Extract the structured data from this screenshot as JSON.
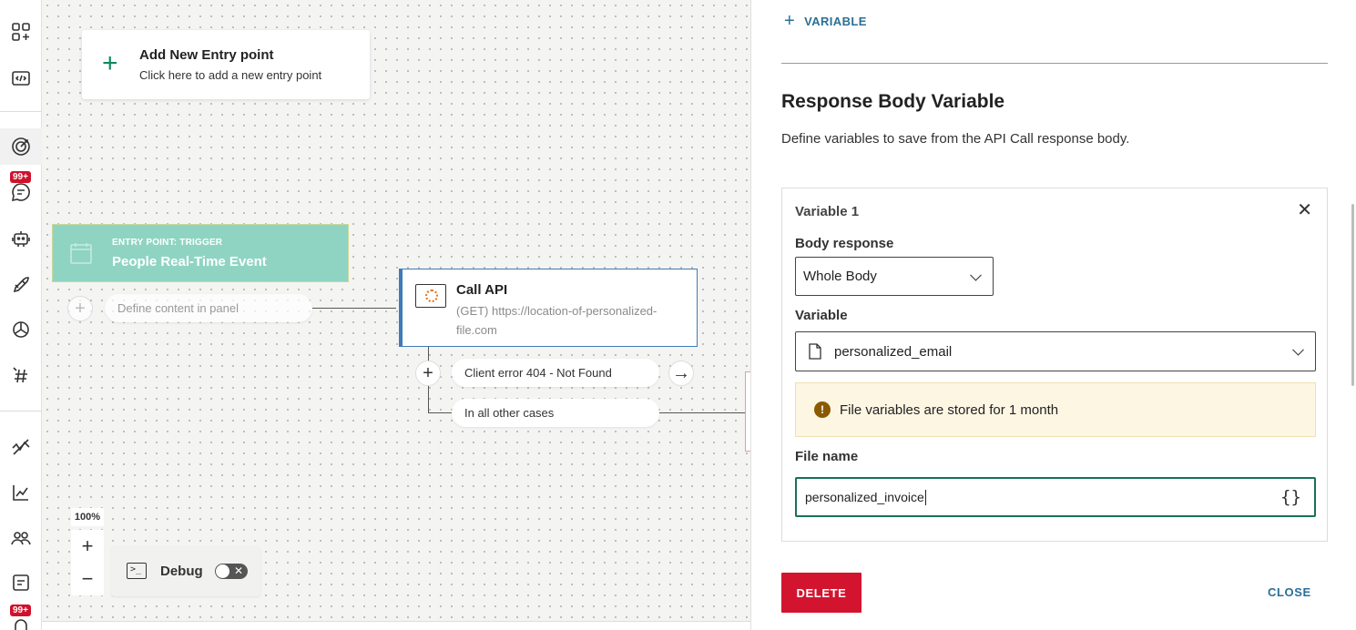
{
  "rail": {
    "badge_messages": "99+",
    "badge_bottom": "99+",
    "icons": [
      "grid-plus-icon",
      "code-icon",
      "target-icon",
      "chat-icon",
      "robot-icon",
      "rocket-icon",
      "openai-icon",
      "hash-icon",
      "activity-icon",
      "chart-icon",
      "people-icon",
      "list-icon",
      "bell-icon"
    ]
  },
  "canvas": {
    "entry_card": {
      "title": "Add New Entry point",
      "subtitle": "Click here to add a new entry point"
    },
    "trigger": {
      "kicker": "ENTRY POINT: TRIGGER",
      "title": "People Real-Time Event"
    },
    "define_pill": "Define content in panel",
    "api_node": {
      "title": "Call API",
      "url": "(GET) https://location-of-personalized-file.com"
    },
    "branches": [
      "Client error 404 - Not Found",
      "In all other cases"
    ],
    "zoom_level": "100%",
    "debug_label": "Debug",
    "debug_enabled": false
  },
  "panel": {
    "add_variable": "VARIABLE",
    "title": "Response Body Variable",
    "description": "Define variables to save from the API Call response body.",
    "variable_card": {
      "heading": "Variable 1",
      "body_response_label": "Body response",
      "body_response_value": "Whole Body",
      "variable_label": "Variable",
      "variable_value": "personalized_email",
      "warning": "File variables are stored for 1 month",
      "file_name_label": "File name",
      "file_name_value": "personalized_invoice"
    },
    "delete_label": "DELETE",
    "close_label": "CLOSE"
  },
  "colors": {
    "trigger_bg": "#8fd4c2",
    "api_border": "#3f7bb5",
    "delete_bg": "#d3142f",
    "link": "#2a6f97",
    "focus_border": "#19705a"
  }
}
